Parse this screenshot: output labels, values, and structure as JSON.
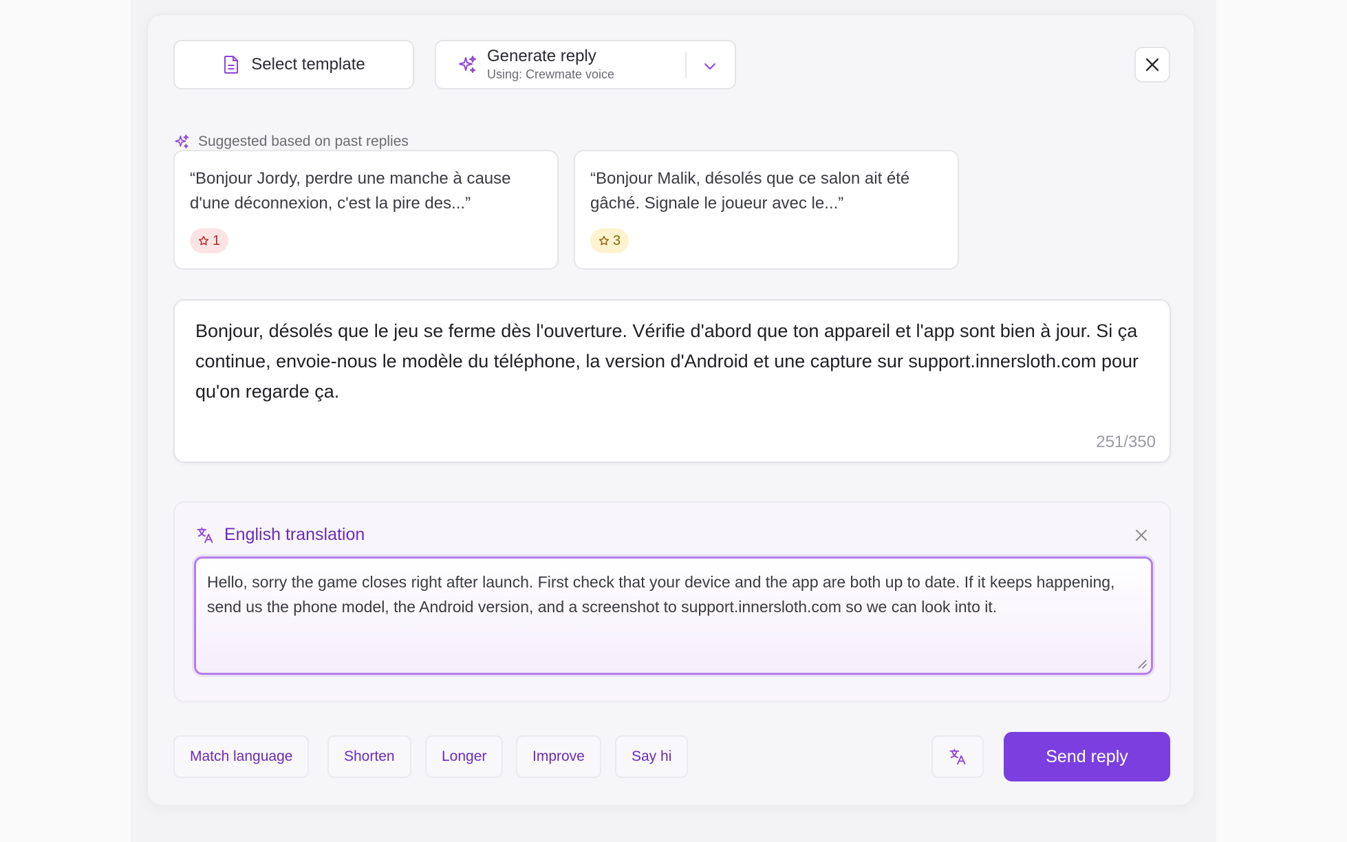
{
  "toolbar": {
    "template_label": "Select template",
    "generate_title": "Generate reply",
    "generate_subtitle": "Using: Crewmate voice"
  },
  "suggestions": {
    "label": "Suggested based on past replies",
    "items": [
      {
        "text": "“Bonjour Jordy, perdre une manche à cause d'une déconnexion, c'est la pire des...”",
        "rating": "1"
      },
      {
        "text": "“Bonjour Malik, désolés que ce salon ait été gâché. Signale le joueur avec le...”",
        "rating": "3"
      }
    ]
  },
  "reply": {
    "text": "Bonjour, désolés que le jeu se ferme dès l'ouverture. Vérifie d'abord que ton appareil et l'app sont bien à jour. Si ça continue, envoie-nous le modèle du téléphone, la version d'Android et une capture sur support.innersloth.com pour qu'on regarde ça.",
    "count": "251/350"
  },
  "translation": {
    "title": "English translation",
    "text": "Hello, sorry the game closes right after launch. First check that your device and the app are both up to date. If it keeps happening, send us the phone model, the Android version, and a screenshot to support.innersloth.com so we can look into it."
  },
  "actions": {
    "chips": [
      "Match language",
      "Shorten",
      "Longer",
      "Improve",
      "Say hi"
    ],
    "send_label": "Send reply"
  },
  "colors": {
    "accent": "#7b3fe0",
    "accent_text": "#6b2bb8",
    "focus_border": "#b47ee8"
  },
  "icons": {
    "template": "document-icon",
    "generate": "sparkles-icon",
    "dropdown": "chevron-down-icon",
    "close": "close-icon",
    "rating": "star-icon",
    "translate": "translate-icon",
    "resize": "resize-grip-icon"
  }
}
